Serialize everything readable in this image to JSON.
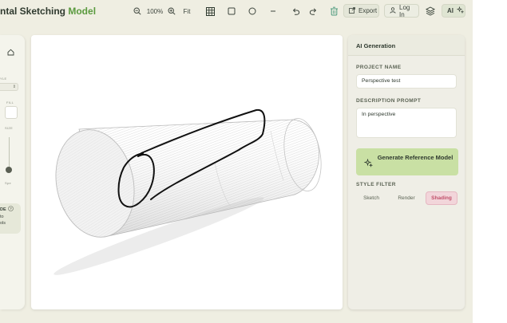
{
  "toolbar": {
    "brand_prefix": "ntal Sketching ",
    "brand_accent": "Model",
    "zoom_value": "100%",
    "fit_label": "Fit",
    "export_label": "Export",
    "login_label": "Log In",
    "ai_label": "AI"
  },
  "left_panel": {
    "style_label": "YLE",
    "fill_label": "FILL",
    "size_label": "SIZE",
    "speed_label": "Spe",
    "hint_title": "DE",
    "hint_line1": "to",
    "hint_line2": "ols"
  },
  "right_panel": {
    "title": "AI Generation",
    "project_label": "PROJECT NAME",
    "project_value": "Perspective test",
    "description_label": "DESCRIPTION PROMPT",
    "description_value": "In perspective",
    "generate_label": "Generate Reference Model",
    "style_filter_label": "STYLE FILTER",
    "filters": [
      "Sketch",
      "Render",
      "Shading"
    ],
    "active_filter": "Shading"
  },
  "colors": {
    "accent_green": "#5a9a3e",
    "generate_bg": "#c9e0a4",
    "active_filter_bg": "#f2d5da",
    "active_filter_text": "#c0506a",
    "trash_icon": "#4e9a7d"
  }
}
